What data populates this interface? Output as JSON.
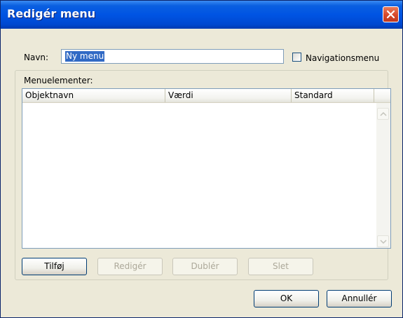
{
  "window": {
    "title": "Redigér menu"
  },
  "form": {
    "name_label": "Navn:",
    "name_value": "Ny menu",
    "navigation_checkbox_label": "Navigationsmenu",
    "navigation_checked": false
  },
  "menu_items": {
    "group_label": "Menuelementer:",
    "columns": [
      "Objektnavn",
      "Værdi",
      "Standard"
    ],
    "rows": []
  },
  "buttons": {
    "add": "Tilføj",
    "edit": "Redigér",
    "duplicate": "Dublér",
    "delete": "Slet",
    "ok": "OK",
    "cancel": "Annullér"
  },
  "icons": {
    "close": "close-icon",
    "scroll_up": "chevron-up-icon",
    "scroll_down": "chevron-down-icon"
  }
}
